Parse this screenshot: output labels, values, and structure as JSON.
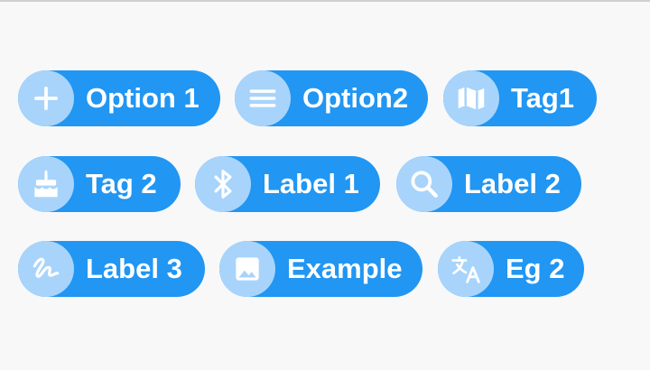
{
  "colors": {
    "chip": "#2196f3",
    "avatar": "#a8d4fb",
    "icon": "#ffffff",
    "text": "#ffffff",
    "background": "#f8f8f9"
  },
  "chips": [
    {
      "label": "Option 1",
      "icon": "add-icon"
    },
    {
      "label": "Option2",
      "icon": "menu-icon"
    },
    {
      "label": "Tag1",
      "icon": "map-icon"
    },
    {
      "label": "Tag 2",
      "icon": "cake-icon"
    },
    {
      "label": "Label 1",
      "icon": "bluetooth-icon"
    },
    {
      "label": "Label 2",
      "icon": "search-icon"
    },
    {
      "label": "Label 3",
      "icon": "gesture-icon"
    },
    {
      "label": "Example",
      "icon": "image-icon"
    },
    {
      "label": "Eg 2",
      "icon": "translate-icon"
    }
  ]
}
